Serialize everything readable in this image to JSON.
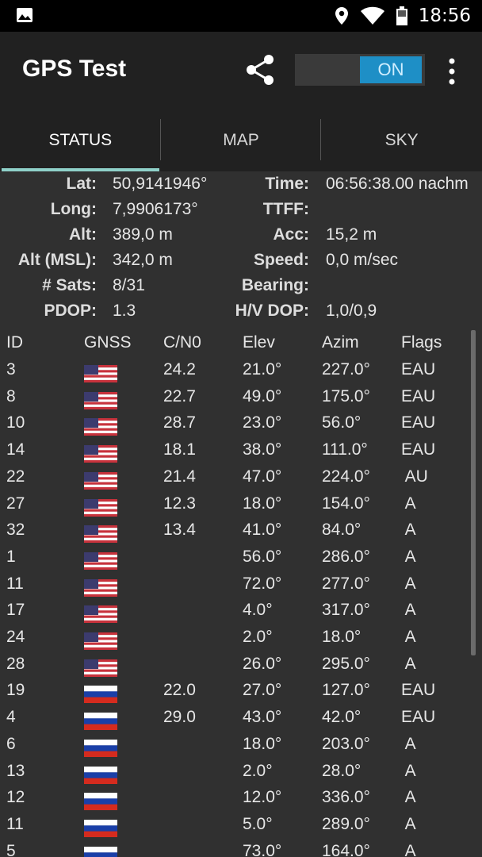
{
  "status_bar": {
    "time": "18:56"
  },
  "app_bar": {
    "title": "GPS Test",
    "toggle_label": "ON"
  },
  "tabs": [
    {
      "label": "STATUS",
      "active": true
    },
    {
      "label": "MAP",
      "active": false
    },
    {
      "label": "SKY",
      "active": false
    }
  ],
  "info": {
    "lat_label": "Lat:",
    "lat": "50,9141946°",
    "long_label": "Long:",
    "long": "7,9906173°",
    "alt_label": "Alt:",
    "alt": "389,0 m",
    "alt_msl_label": "Alt (MSL):",
    "alt_msl": "342,0 m",
    "sats_label": "# Sats:",
    "sats": "8/31",
    "pdop_label": "PDOP:",
    "pdop": "1.3",
    "time_label": "Time:",
    "time": "06:56:38.00 nachm",
    "ttff_label": "TTFF:",
    "ttff": "",
    "acc_label": "Acc:",
    "acc": "15,2 m",
    "speed_label": "Speed:",
    "speed": "0,0 m/sec",
    "bearing_label": "Bearing:",
    "bearing": "",
    "hvdop_label": "H/V DOP:",
    "hvdop": "1,0/0,9"
  },
  "table": {
    "headers": {
      "id": "ID",
      "gnss": "GNSS",
      "cn0": "C/N0",
      "elev": "Elev",
      "azim": "Azim",
      "flags": "Flags"
    },
    "rows": [
      {
        "id": "3",
        "gnss": "us",
        "cn0": "24.2",
        "elev": "21.0°",
        "azim": "227.0°",
        "flags": "EAU"
      },
      {
        "id": "8",
        "gnss": "us",
        "cn0": "22.7",
        "elev": "49.0°",
        "azim": "175.0°",
        "flags": "EAU"
      },
      {
        "id": "10",
        "gnss": "us",
        "cn0": "28.7",
        "elev": "23.0°",
        "azim": "56.0°",
        "flags": "EAU"
      },
      {
        "id": "14",
        "gnss": "us",
        "cn0": "18.1",
        "elev": "38.0°",
        "azim": "111.0°",
        "flags": "EAU"
      },
      {
        "id": "22",
        "gnss": "us",
        "cn0": "21.4",
        "elev": "47.0°",
        "azim": "224.0°",
        "flags": " AU"
      },
      {
        "id": "27",
        "gnss": "us",
        "cn0": "12.3",
        "elev": "18.0°",
        "azim": "154.0°",
        "flags": " A"
      },
      {
        "id": "32",
        "gnss": "us",
        "cn0": "13.4",
        "elev": "41.0°",
        "azim": "84.0°",
        "flags": " A"
      },
      {
        "id": "1",
        "gnss": "us",
        "cn0": "",
        "elev": "56.0°",
        "azim": "286.0°",
        "flags": " A"
      },
      {
        "id": "11",
        "gnss": "us",
        "cn0": "",
        "elev": "72.0°",
        "azim": "277.0°",
        "flags": " A"
      },
      {
        "id": "17",
        "gnss": "us",
        "cn0": "",
        "elev": "4.0°",
        "azim": "317.0°",
        "flags": " A"
      },
      {
        "id": "24",
        "gnss": "us",
        "cn0": "",
        "elev": "2.0°",
        "azim": "18.0°",
        "flags": " A"
      },
      {
        "id": "28",
        "gnss": "us",
        "cn0": "",
        "elev": "26.0°",
        "azim": "295.0°",
        "flags": " A"
      },
      {
        "id": "19",
        "gnss": "ru",
        "cn0": "22.0",
        "elev": "27.0°",
        "azim": "127.0°",
        "flags": "EAU"
      },
      {
        "id": "4",
        "gnss": "ru",
        "cn0": "29.0",
        "elev": "43.0°",
        "azim": "42.0°",
        "flags": "EAU"
      },
      {
        "id": "6",
        "gnss": "ru",
        "cn0": "",
        "elev": "18.0°",
        "azim": "203.0°",
        "flags": " A"
      },
      {
        "id": "13",
        "gnss": "ru",
        "cn0": "",
        "elev": "2.0°",
        "azim": "28.0°",
        "flags": " A"
      },
      {
        "id": "12",
        "gnss": "ru",
        "cn0": "",
        "elev": "12.0°",
        "azim": "336.0°",
        "flags": " A"
      },
      {
        "id": "11",
        "gnss": "ru",
        "cn0": "",
        "elev": "5.0°",
        "azim": "289.0°",
        "flags": " A"
      },
      {
        "id": "5",
        "gnss": "ru",
        "cn0": "",
        "elev": "73.0°",
        "azim": "164.0°",
        "flags": " A"
      }
    ]
  },
  "colors": {
    "accent": "#1e8fc6",
    "tab_indicator": "#8fd1c9",
    "background": "#303030",
    "appbar": "#212121"
  }
}
